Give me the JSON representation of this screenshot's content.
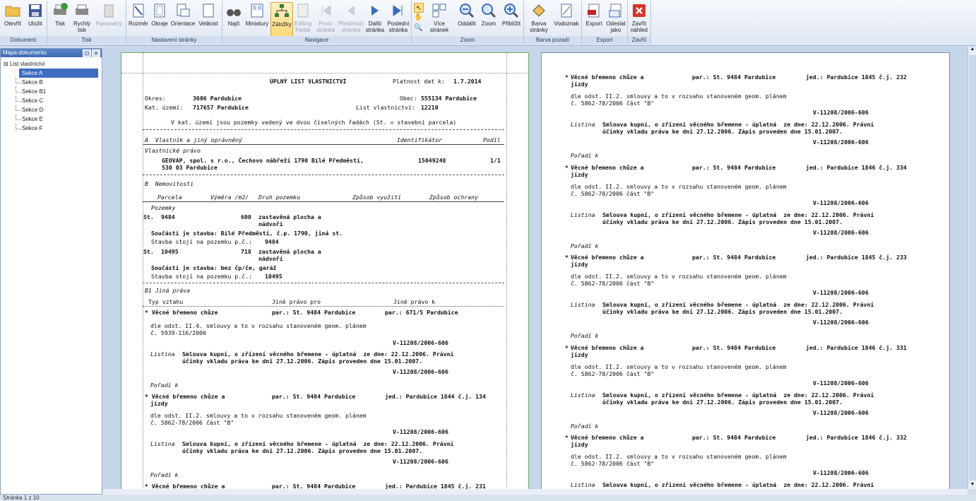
{
  "ribbon": {
    "groups": [
      {
        "label": "Dokument",
        "buttons": [
          "Otevřít",
          "Uložit"
        ]
      },
      {
        "label": "Tisk",
        "buttons": [
          "Tisk",
          "Rychlý tisk",
          "Parametry"
        ]
      },
      {
        "label": "Nastavení stránky",
        "buttons": [
          "Rozměr",
          "Okraje",
          "Orientace",
          "Velikost"
        ]
      },
      {
        "label": "Navigace",
        "buttons": [
          "Najít",
          "Miniatury",
          "Záložky",
          "Editing Fields",
          "První stránka",
          "Předchozí stránka",
          "Další stránka",
          "Poslední stránka"
        ]
      },
      {
        "label": "Zoom",
        "buttons": [
          "Více stránek",
          "Oddálit",
          "Zoom",
          "Přiblížit"
        ]
      },
      {
        "label": "Barva pozadí",
        "buttons": [
          "Barva stránky",
          "Vodoznak"
        ]
      },
      {
        "label": "Export",
        "buttons": [
          "Export",
          "Odeslat jako"
        ]
      },
      {
        "label": "Zavřít",
        "buttons": [
          "Zavřít náhled"
        ]
      }
    ]
  },
  "sidepanel": {
    "title": "Mapa dokumentu",
    "root": "List vlastnictví",
    "items": [
      "Sekce A",
      "Sekce B",
      "Sekce B1",
      "Sekce C",
      "Sekce D",
      "Sekce E",
      "Sekce F"
    ]
  },
  "page1": {
    "title": "ÚPLNÝ LIST VLASTNICTVÍ",
    "platnost_label": "Platnost dat k:",
    "platnost": "1.7.2014",
    "okres_label": "Okres:",
    "okres": "3606 Pardubice",
    "obec_label": "Obec:",
    "obec": "555134 Pardubice",
    "katuz_label": "Kat. území:",
    "katuz": "717657 Pardubice",
    "lv_label": "List vlastnictví:",
    "lv": "12210",
    "note": "V kat. území jsou pozemky vedený ve dvou číselných řadách (St. = stavební parcela)",
    "secA": "A  Vlastník a jiný oprávněný",
    "ident": "Identifikátor",
    "podil": "Podíl",
    "vlastnicke": "Vlastnické právo",
    "owner1": "GEOVAP, spol. s r.o., Čechovo nábřeží 1790 Bílé Předměstí,",
    "owner2": "530 03 Pardubice",
    "owner_id": "15049248",
    "owner_podil": "1/1",
    "secB": "B  Nemovitosti",
    "colB": [
      "Parcela",
      "Výměra /m2/",
      "Druh pozemku",
      "Způsob využití",
      "Způsob ochrany"
    ],
    "pozemky": "Pozemky",
    "p1": {
      "st": "St.",
      "num": "9484",
      "area": "600",
      "druh1": "zastavěná plocha a",
      "druh2": "nádvoří",
      "stavba": "Součástí je stavba: Bílé Předměstí, č.p. 1790, jiná st.",
      "stoji": "Stavba stojí na pozemku p.č.:",
      "stoji_num": "9484"
    },
    "p2": {
      "st": "St.",
      "num": "10495",
      "area": "718",
      "druh1": "zastavěná plocha a",
      "druh2": "nádvoří",
      "stavba": "Součástí je stavba: bez čp/če, garáž",
      "stoji": "Stavba stojí na pozemku p.č.:",
      "stoji_num": "10495"
    },
    "secB1": "B1 Jiná práva",
    "colB1": [
      "Typ vztahu",
      "Jiné právo pro",
      "Jiné právo k"
    ],
    "e1": {
      "typ": "Věcné břemeno chůze",
      "pro": "par.: St. 9484 Pardubice",
      "k": "par.: 671/5 Pardubice",
      "dle1": "dle odst. II.4. smlouvy a to v rozsahu stanoveném geom. plánem",
      "dle2": "č. 5939-116/2006",
      "v1": "V-11208/2006-606",
      "listina": "Listina",
      "lt1": "Smlouva kupní, o zřízení věcného břemene - úplatná  ze dne: 22.12.2006. Právní",
      "lt2": "účinky vkladu práva ke dni 27.12.2006. Zápis proveden dne 15.01.2007.",
      "v2": "V-11208/2006-606"
    },
    "e2": {
      "poradi": "Pořadí k",
      "typ1": "Věcné břemeno chůze a",
      "typ2": "jízdy",
      "pro": "par.: St. 9484 Pardubice",
      "k": "jed.: Pardubice 1844 č.j. 134",
      "dle1": "dle odst. II.2. smlouvy a to v rozsahu stanoveném geom. plánem",
      "dle2": "č. 5862-78/2006 část \"B\"",
      "v1": "V-11208/2006-606",
      "listina": "Listina",
      "lt1": "Smlouva kupní, o zřízení věcného břemene - úplatná  ze dne: 22.12.2006. Právní",
      "lt2": "účinky vkladu práva ke dni 27.12.2006. Zápis proveden dne 15.01.2007.",
      "v2": "V-11208/2006-606"
    },
    "e3": {
      "poradi": "Pořadí k",
      "typ1": "Věcné břemeno chůze a",
      "pro": "par.: St. 9484 Pardubice",
      "k": "jed.: Pardubice 1845 č.j. 231"
    }
  },
  "page2": {
    "entries": [
      {
        "k": "jed.: Pardubice 1845 č.j. 232"
      },
      {
        "k": "jed.: Pardubice 1846 č.j. 334"
      },
      {
        "k": "jed.: Pardubice 1845 č.j. 233"
      },
      {
        "k": "jed.: Pardubice 1846 č.j. 331"
      },
      {
        "k": "jed.: Pardubice 1846 č.j. 332"
      }
    ],
    "typ1": "Věcné břemeno chůze a",
    "typ2": "jízdy",
    "pro": "par.: St. 9484 Pardubice",
    "dle1": "dle odst. II.2. smlouvy a to v rozsahu stanoveném geom. plánem",
    "dle2": "č. 5862-78/2006 část \"B\"",
    "v": "V-11208/2006-606",
    "listina": "Listina",
    "lt1": "Smlouva kupní, o zřízení věcného břemene - úplatná  ze dne: 22.12.2006. Právní",
    "lt2": "účinky vkladu práva ke dni 27.12.2006. Zápis proveden dne 15.01.2007.",
    "poradi": "Pořadí k"
  },
  "status": {
    "text": "Stránka 1 z 10"
  }
}
